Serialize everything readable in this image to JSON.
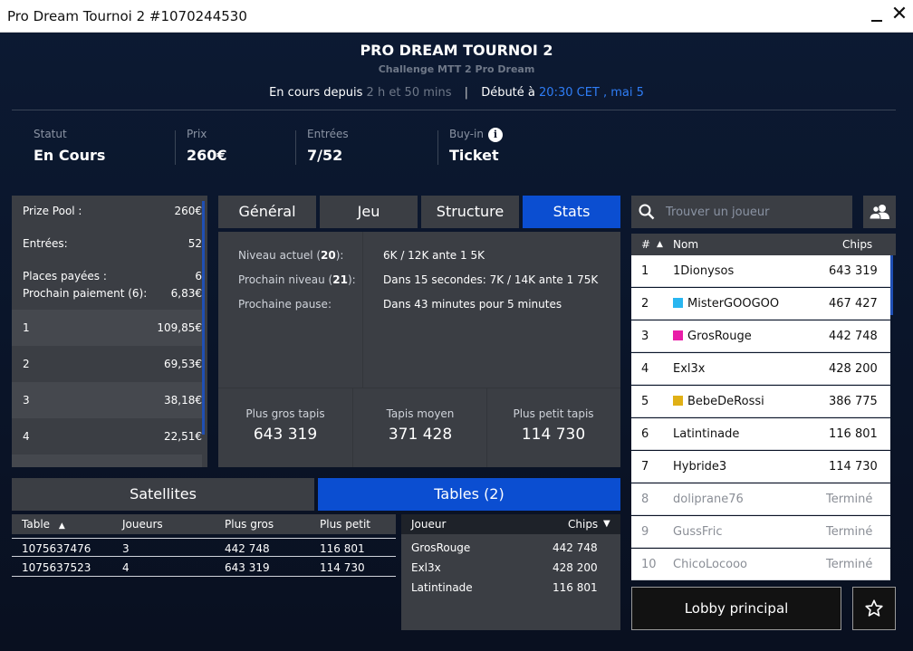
{
  "window": {
    "title": "Pro Dream Tournoi 2 #1070244530"
  },
  "header": {
    "title": "PRO DREAM TOURNOI 2",
    "subtitle": "Challenge MTT 2 Pro Dream",
    "running_label": "En cours depuis",
    "running_value": "2 h et 50 mins",
    "separator": "|",
    "started_label": "Débuté à",
    "started_value": "20:30 CET , mai 5"
  },
  "stats": {
    "statut": {
      "label": "Statut",
      "value": "En Cours"
    },
    "prix": {
      "label": "Prix",
      "value": "260€"
    },
    "entrees": {
      "label": "Entrées",
      "value": "7/52"
    },
    "buyin": {
      "label": "Buy-in",
      "value": "Ticket",
      "info_icon": "i"
    }
  },
  "prize_panel": {
    "prize_pool_label": "Prize Pool :",
    "prize_pool_value": "260€",
    "entries_label": "Entrées:",
    "entries_value": "52",
    "paid_places_label": "Places payées :",
    "paid_places_value": "6",
    "next_payout_label": "Prochain paiement (6):",
    "next_payout_value": "6,83€",
    "payouts": [
      {
        "place": "1",
        "amount": "109,85€"
      },
      {
        "place": "2",
        "amount": "69,53€"
      },
      {
        "place": "3",
        "amount": "38,18€"
      },
      {
        "place": "4",
        "amount": "22,51€"
      }
    ]
  },
  "center_tabs": [
    "Général",
    "Jeu",
    "Structure",
    "Stats"
  ],
  "stats_panel": {
    "current_level_label": "Niveau actuel (",
    "current_level_num": "20",
    "current_level_end": "):",
    "current_level_value": "6K / 12K ante 1 5K",
    "next_level_label": "Prochain niveau (",
    "next_level_num": "21",
    "next_level_end": "):",
    "next_level_value": "Dans 15 secondes: 7K / 14K ante 1 75K",
    "next_break_label": "Prochaine pause:",
    "next_break_value": "Dans 43 minutes pour 5 minutes",
    "biggest_label": "Plus gros tapis",
    "biggest_value": "643 319",
    "average_label": "Tapis moyen",
    "average_value": "371 428",
    "smallest_label": "Plus petit tapis",
    "smallest_value": "114 730"
  },
  "bottom_tabs": {
    "satellites": "Satellites",
    "tables": "Tables (2)"
  },
  "tables": {
    "headers": [
      "Table",
      "Joueurs",
      "Plus gros",
      "Plus petit"
    ],
    "sort_icon": "▲",
    "rows": [
      [
        "1075637476",
        "3",
        "442 748",
        "116 801"
      ],
      [
        "1075637523",
        "4",
        "643 319",
        "114 730"
      ]
    ]
  },
  "table_players": {
    "headers": [
      "Joueur",
      "Chips"
    ],
    "sort_icon": "▼",
    "rows": [
      [
        "GrosRouge",
        "442 748"
      ],
      [
        "Exl3x",
        "428 200"
      ],
      [
        "Latintinade",
        "116 801"
      ]
    ]
  },
  "search": {
    "placeholder": "Trouver un joueur"
  },
  "players": {
    "headers": {
      "rank": "#",
      "sort_icon": "▲",
      "name": "Nom",
      "chips": "Chips"
    },
    "rows": [
      {
        "rank": "1",
        "name": "1Dionysos",
        "chips": "643 319",
        "color": ""
      },
      {
        "rank": "2",
        "name": "MisterGOOGOO",
        "chips": "467 427",
        "color": "#29b6f0"
      },
      {
        "rank": "3",
        "name": "GrosRouge",
        "chips": "442 748",
        "color": "#e91ea8"
      },
      {
        "rank": "4",
        "name": "Exl3x",
        "chips": "428 200",
        "color": ""
      },
      {
        "rank": "5",
        "name": "BebeDeRossi",
        "chips": "386 775",
        "color": "#e0b016"
      },
      {
        "rank": "6",
        "name": "Latintinade",
        "chips": "116 801",
        "color": ""
      },
      {
        "rank": "7",
        "name": "Hybride3",
        "chips": "114 730",
        "color": ""
      },
      {
        "rank": "8",
        "name": "dolipranе76",
        "chips": "Terminé",
        "color": ""
      },
      {
        "rank": "9",
        "name": "GussFric",
        "chips": "Terminé",
        "color": ""
      },
      {
        "rank": "10",
        "name": "ChicoLocooo",
        "chips": "Terminé",
        "color": ""
      }
    ]
  },
  "buttons": {
    "lobby": "Lobby principal"
  },
  "colors": {
    "accent": "#0b4ed1",
    "panel": "#3b3e44",
    "link": "#2f7df6"
  }
}
